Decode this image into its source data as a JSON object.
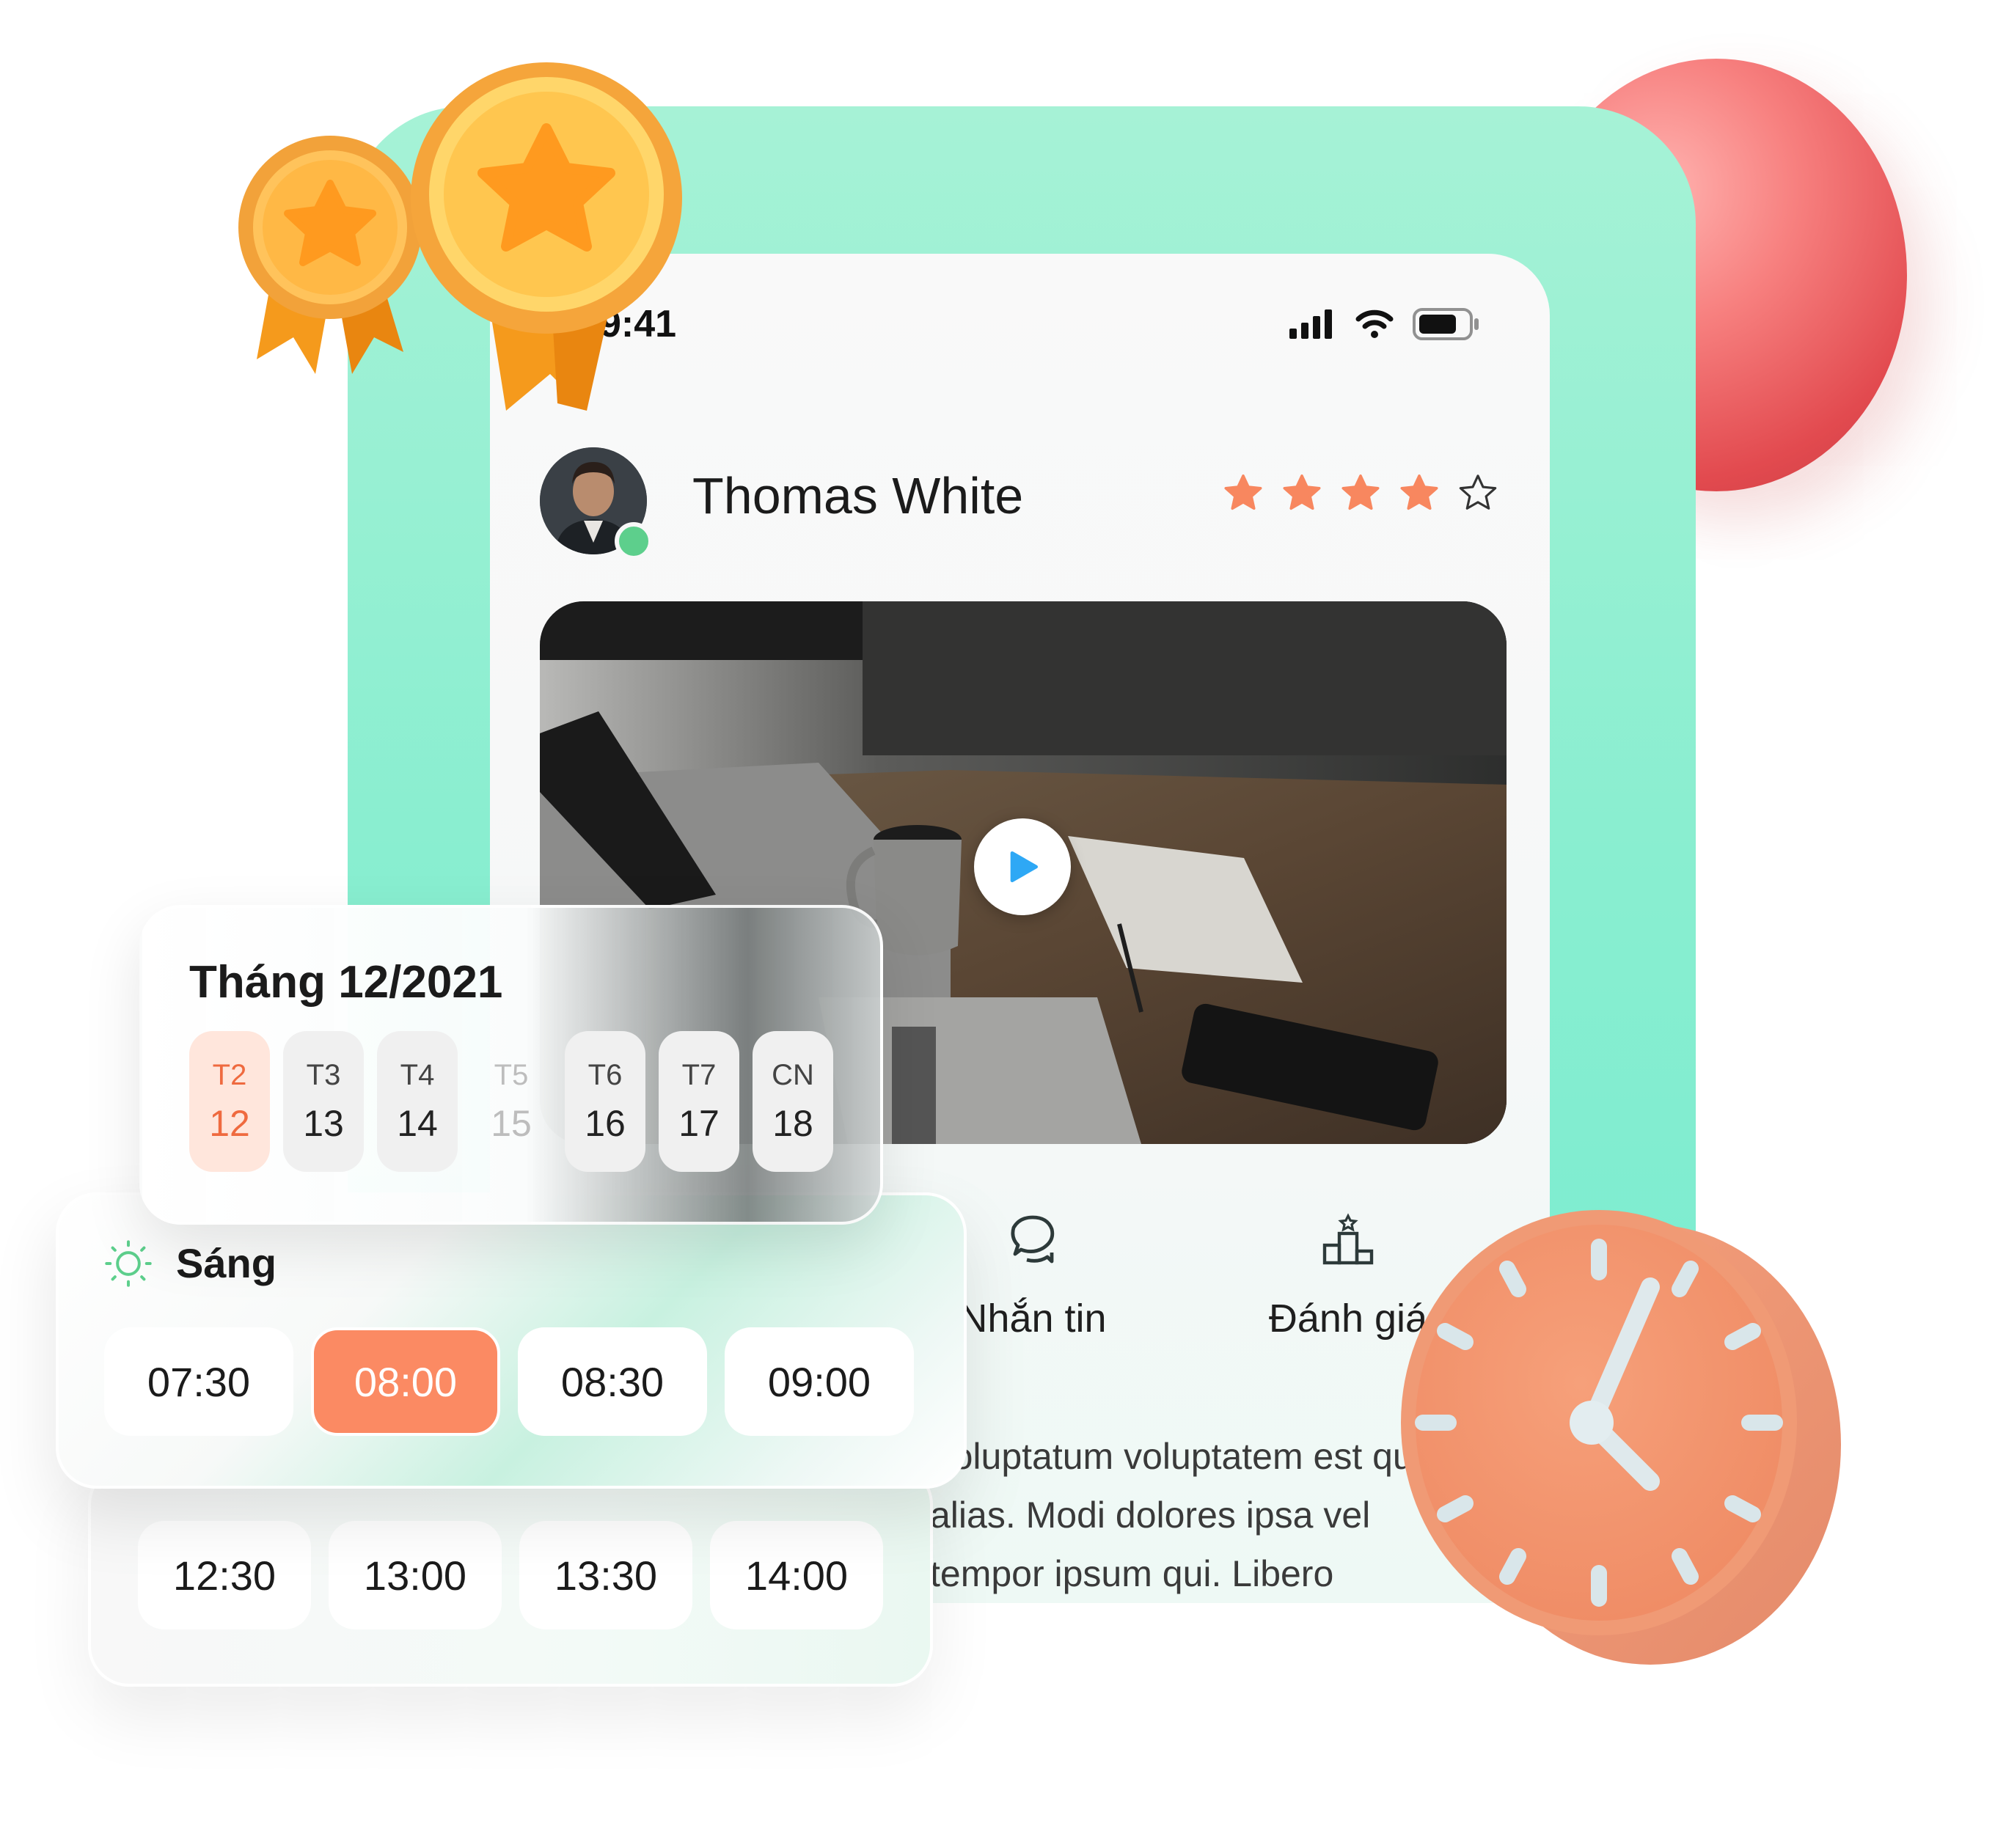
{
  "status_bar": {
    "time": "9:41"
  },
  "profile": {
    "name": "Thomas White",
    "rating": 4,
    "max_rating": 5
  },
  "actions": [
    {
      "label": "Nhắn tin",
      "icon": "chat-icon"
    },
    {
      "label": "Đánh giá",
      "icon": "podium-icon"
    }
  ],
  "description": {
    "lines": [
      "Voluptatum voluptatem est qui",
      "alias. Modi dolores ipsa vel",
      "tempor ipsum qui. Libero repellendus"
    ]
  },
  "calendar": {
    "title": "Tháng 12/2021",
    "days": [
      {
        "name": "T2",
        "date": "12",
        "state": "active"
      },
      {
        "name": "T3",
        "date": "13",
        "state": "normal"
      },
      {
        "name": "T4",
        "date": "14",
        "state": "normal"
      },
      {
        "name": "T5",
        "date": "15",
        "state": "disabled"
      },
      {
        "name": "T6",
        "date": "16",
        "state": "normal"
      },
      {
        "name": "T7",
        "date": "17",
        "state": "normal"
      },
      {
        "name": "CN",
        "date": "18",
        "state": "normal"
      }
    ]
  },
  "morning": {
    "label": "Sáng",
    "slots": [
      "07:30",
      "08:00",
      "08:30",
      "09:00"
    ],
    "selected": "08:00"
  },
  "afternoon": {
    "slots": [
      "12:30",
      "13:00",
      "13:30",
      "14:00"
    ]
  },
  "colors": {
    "accent": "#fb8a63",
    "mint": "#8df0d1",
    "star": "#f8875f",
    "online": "#5dcf8c"
  }
}
